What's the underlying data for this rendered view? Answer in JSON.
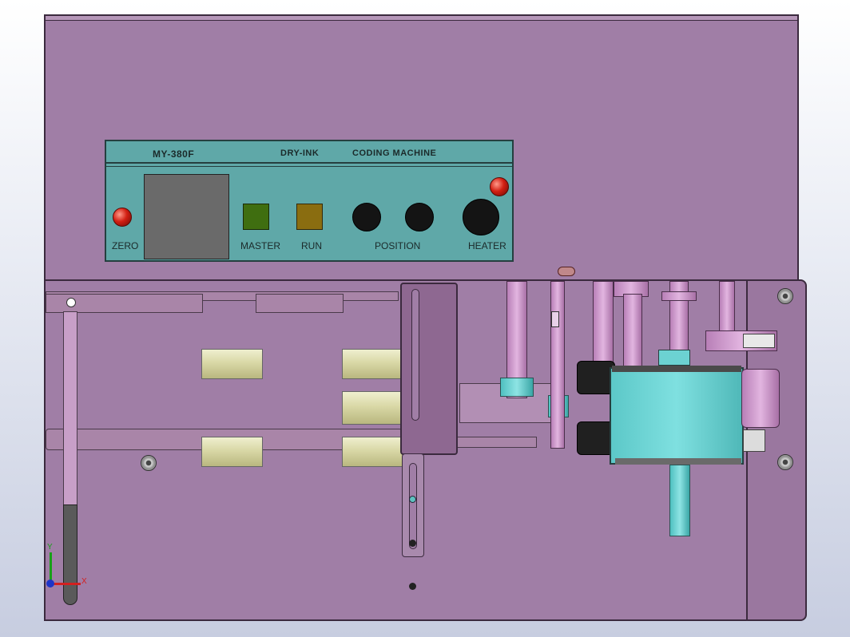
{
  "panel": {
    "model": "MY-380F",
    "subtitle_1": "DRY-INK",
    "subtitle_2": "CODING MACHINE",
    "zero_label": "ZERO",
    "master_label": "MASTER",
    "run_label": "RUN",
    "position_label": "POSITION",
    "heater_label": "HEATER"
  },
  "axes": {
    "x_label": "X",
    "y_label": "Y"
  },
  "colors": {
    "housing": "#a07ea6",
    "panel": "#5fa8a8",
    "master_button": "#3f6e10",
    "run_button": "#8a6d10",
    "display": "#6a6a6a",
    "teal_part": "#6cd2d2"
  }
}
